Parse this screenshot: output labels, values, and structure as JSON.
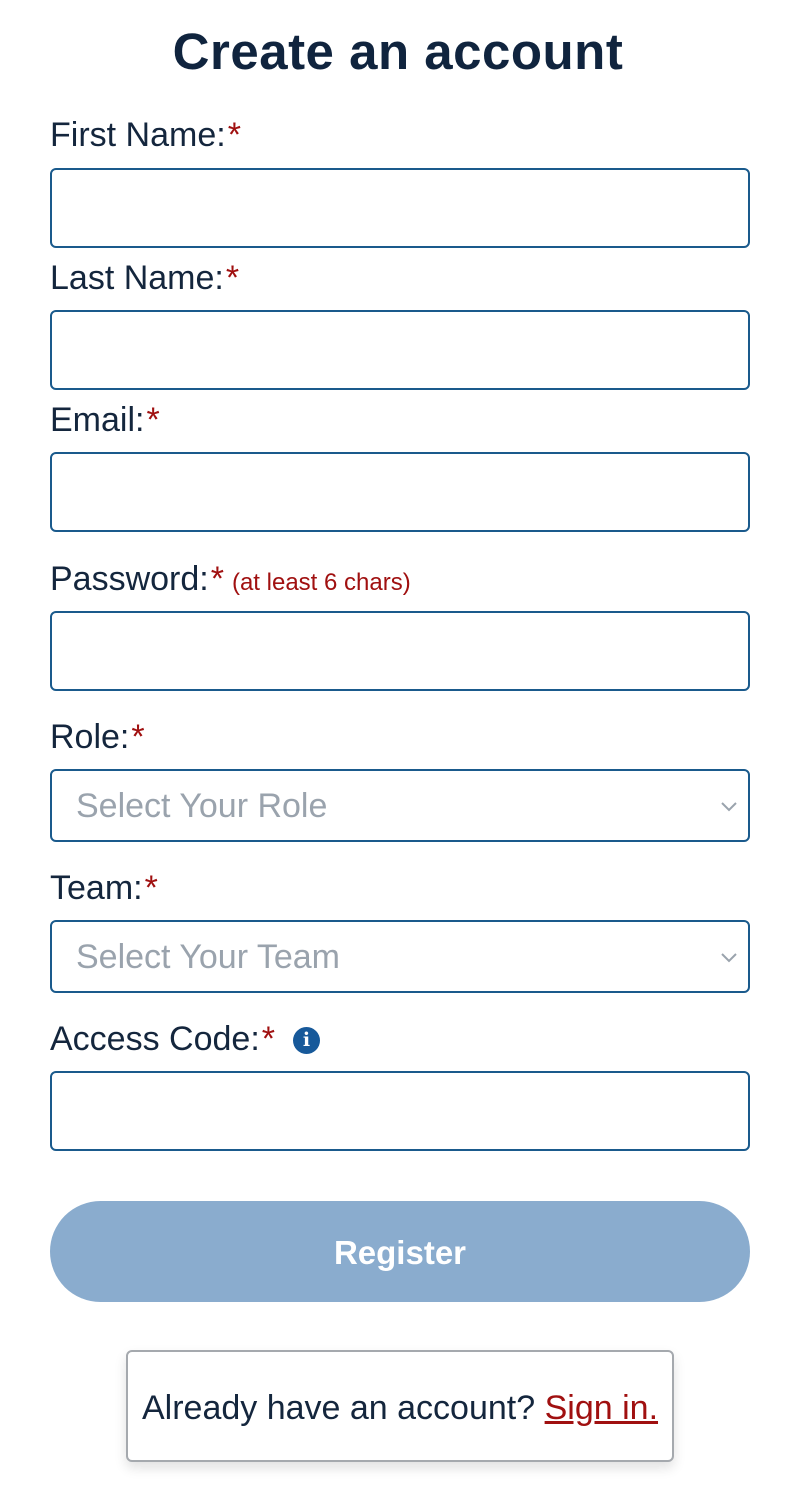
{
  "page": {
    "title": "Create an account"
  },
  "form": {
    "first_name": {
      "label": "First Name:",
      "required_mark": "*",
      "value": "",
      "placeholder": ""
    },
    "last_name": {
      "label": "Last Name:",
      "required_mark": "*",
      "value": "",
      "placeholder": ""
    },
    "email": {
      "label": "Email:",
      "required_mark": "*",
      "value": "",
      "placeholder": ""
    },
    "password": {
      "label": "Password:",
      "required_mark": "*",
      "hint": "(at least 6 chars)",
      "value": "",
      "placeholder": ""
    },
    "role": {
      "label": "Role:",
      "required_mark": "*",
      "selected": "Select Your Role",
      "icon": "chevron-down-icon"
    },
    "team": {
      "label": "Team:",
      "required_mark": "*",
      "selected": "Select Your Team",
      "icon": "chevron-down-icon"
    },
    "access_code": {
      "label": "Access Code:",
      "required_mark": "*",
      "info_icon": "info-icon",
      "info_glyph": "i",
      "value": "",
      "placeholder": ""
    },
    "register_label": "Register"
  },
  "signin": {
    "prompt": "Already have an account?",
    "link_text": "Sign in."
  },
  "colors": {
    "heading": "#10243e",
    "required": "#a01010",
    "field_border": "#1a5a8c",
    "register_bg": "#8aacce",
    "placeholder": "#9aa3ad",
    "link": "#a01010"
  }
}
